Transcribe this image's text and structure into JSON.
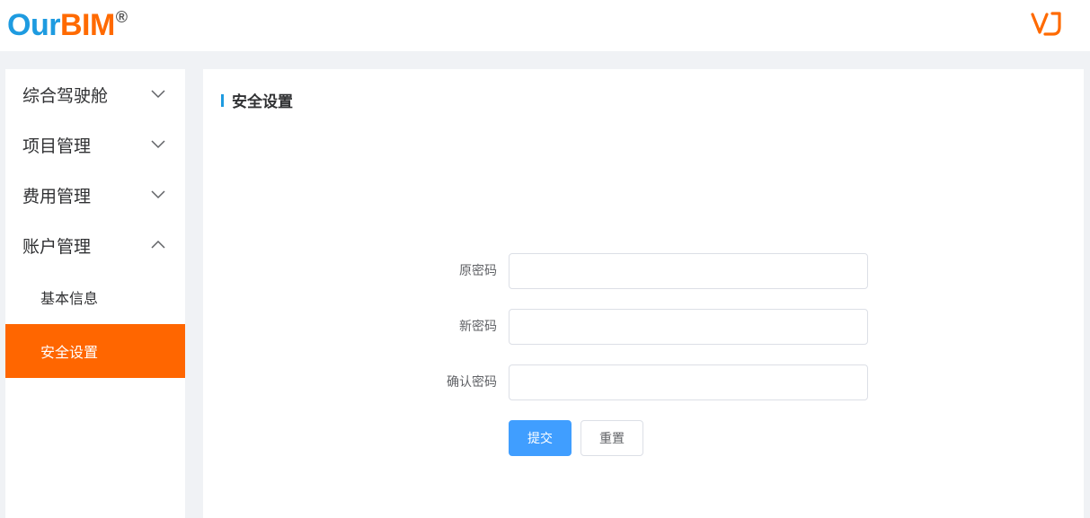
{
  "header": {
    "logo_text_1": "Our",
    "logo_text_2": "BIM",
    "logo_reg": "®",
    "user_logo_icon": "vj-logo-icon"
  },
  "sidebar": {
    "items": [
      {
        "label": "综合驾驶舱",
        "icon": "chevron-down-icon"
      },
      {
        "label": "项目管理",
        "icon": "chevron-down-icon"
      },
      {
        "label": "费用管理",
        "icon": "chevron-down-icon"
      },
      {
        "label": "账户管理",
        "icon": "chevron-up-icon",
        "expanded": true,
        "children": [
          {
            "label": "基本信息",
            "active": false
          },
          {
            "label": "安全设置",
            "active": true
          }
        ]
      }
    ]
  },
  "main": {
    "title": "安全设置",
    "form": {
      "old_password_label": "原密码",
      "old_password_value": "",
      "new_password_label": "新密码",
      "new_password_value": "",
      "confirm_password_label": "确认密码",
      "confirm_password_value": ""
    },
    "submit_label": "提交",
    "reset_label": "重置"
  },
  "colors": {
    "brand_blue": "#1e9be0",
    "brand_orange": "#ff6600",
    "primary_button": "#409eff"
  }
}
